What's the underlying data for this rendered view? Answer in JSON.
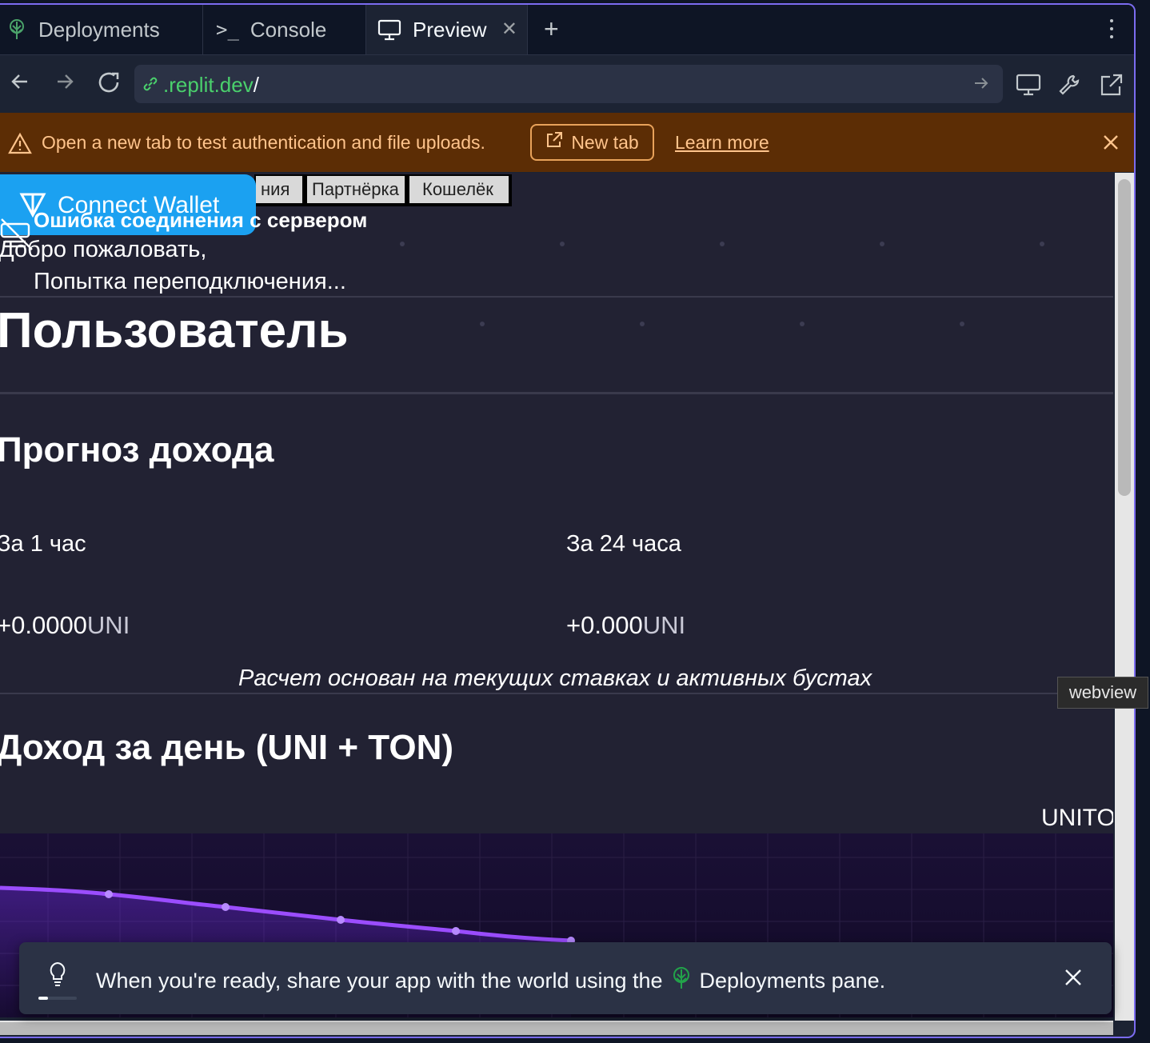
{
  "tabs": {
    "deployments": "Deployments",
    "console": "Console",
    "console_prompt": ">_",
    "preview": "Preview"
  },
  "url": {
    "host": ".replit.dev",
    "path": "/"
  },
  "banner": {
    "message": "Open a new tab to test authentication and file uploads.",
    "new_tab": "New tab",
    "learn_more": "Learn more"
  },
  "webview": {
    "nav_buttons": [
      "ния",
      "Партнёрка",
      "Кошелёк"
    ],
    "connect_wallet": "Connect Wallet",
    "error": "Ошибка соединения с сервером",
    "welcome": "Добро пожаловать,",
    "reconnecting": "Попытка переподключения...",
    "user_title": "Пользователь",
    "forecast_title": "Прогноз дохода",
    "per_hour_label": "За 1 час",
    "per_day_label": "За 24 часа",
    "per_hour_value": "+0.0000",
    "per_day_value": "+0.000",
    "unit": "UNI",
    "note": "Расчет основан на текущих ставках и активных бустах",
    "daily_income_title": "Доход за день (UNI + TON)",
    "chart_legend": "UNITO"
  },
  "tooltip": "webview",
  "toast": {
    "text_before": "When you're ready, share your app with the world using the",
    "text_after": "Deployments pane."
  },
  "colors": {
    "accent": "#7b6cf0",
    "banner_bg": "#5c2d05",
    "banner_text": "#ffc48c",
    "url_green": "#4ad06c",
    "connect_blue": "#1ba1f1",
    "chart_line": "#9b4dff"
  },
  "icons": {
    "deployments": "deployments-tree-icon",
    "preview": "monitor-icon",
    "back": "arrow-left-icon",
    "forward": "arrow-right-icon",
    "reload": "reload-icon",
    "link": "link-icon",
    "warning": "warning-triangle-icon",
    "external": "external-link-icon",
    "tip": "lightbulb-icon"
  }
}
